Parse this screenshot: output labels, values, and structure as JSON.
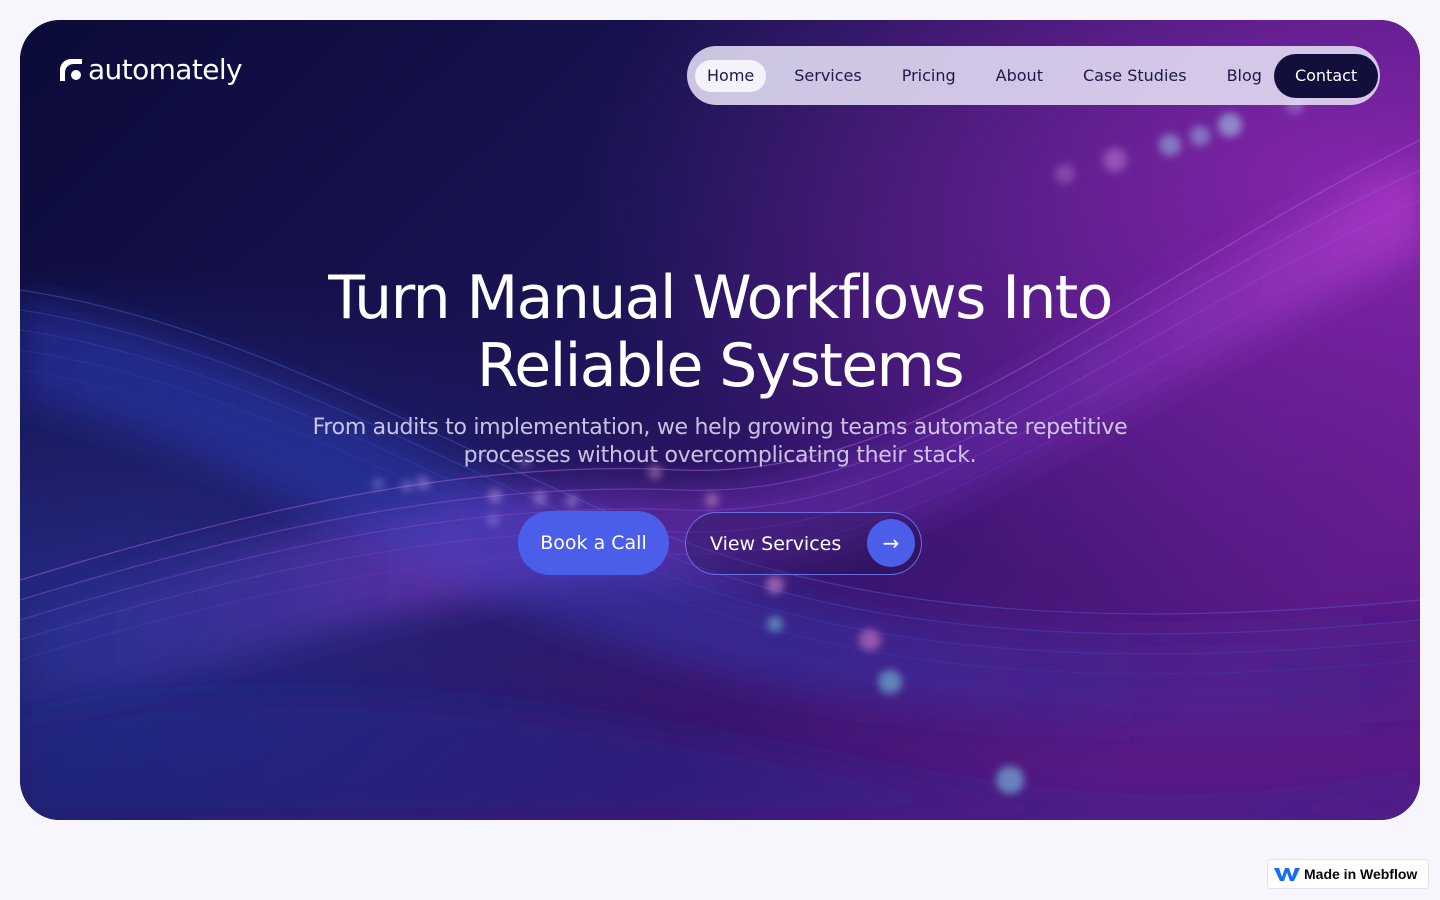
{
  "brand": {
    "name": "automately",
    "accent": "#4a5eea",
    "dark": "#130f3c"
  },
  "nav": {
    "items": [
      {
        "label": "Home",
        "active": true
      },
      {
        "label": "Services"
      },
      {
        "label": "Pricing"
      },
      {
        "label": "About"
      },
      {
        "label": "Case Studies"
      },
      {
        "label": "Blog"
      }
    ],
    "contact_label": "Contact"
  },
  "hero": {
    "headline_line1": "Turn Manual Workflows Into",
    "headline_line2": "Reliable Systems",
    "subtext_line1": "From audits to implementation, we help growing teams automate repetitive",
    "subtext_line2": "processes without overcomplicating their stack.",
    "primary_cta": "Book a Call",
    "secondary_cta": "View Services",
    "secondary_icon": "arrow-right-icon"
  },
  "badge": {
    "label": "Made in Webflow",
    "icon": "webflow-logo-icon"
  }
}
